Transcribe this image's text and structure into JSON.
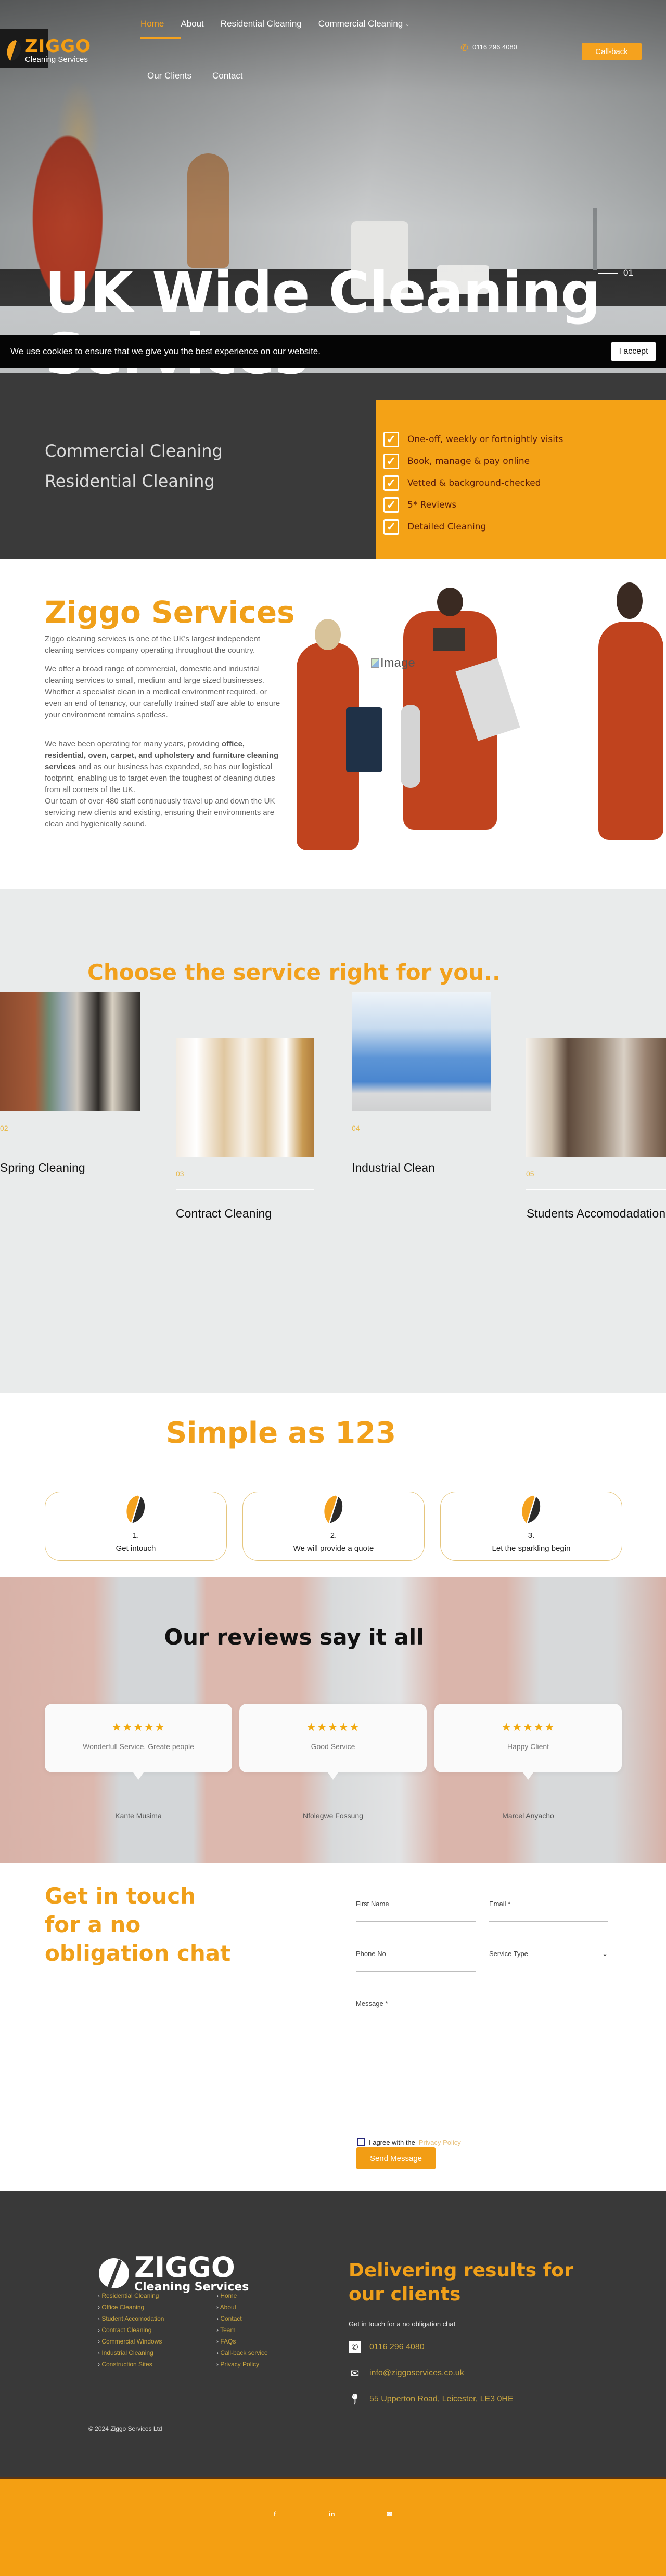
{
  "brand": {
    "name": "ZIGGO",
    "tagline": "Cleaning Services",
    "accent_color": "#f5a21e",
    "dark_color": "#3a3a3a"
  },
  "header": {
    "nav": [
      {
        "label": "Home",
        "active": true
      },
      {
        "label": "About"
      },
      {
        "label": "Residential Cleaning"
      },
      {
        "label": "Commercial Cleaning",
        "has_dropdown": true
      },
      {
        "label": "Our Clients"
      },
      {
        "label": "Contact"
      }
    ],
    "phone": "0116 296 4080",
    "callback_label": "Call-back"
  },
  "hero": {
    "title": "UK Wide Cleaning Services",
    "slide_number": "01",
    "links": [
      "Commercial Cleaning",
      "Residential Cleaning"
    ],
    "features": [
      "One-off, weekly or fortnightly visits",
      "Book, manage & pay online",
      "Vetted & background-checked",
      "5* Reviews",
      "Detailed Cleaning"
    ]
  },
  "cookie": {
    "text": "We use cookies to ensure that we give you the best experience on our website.",
    "accept_label": "I accept"
  },
  "about": {
    "title": "Ziggo Services",
    "p1": "Ziggo cleaning services is one of the UK's largest independent cleaning services company operating throughout the country.",
    "p2": "We offer a broad range of commercial, domestic and industrial cleaning services to small, medium and large sized businesses. Whether a specialist clean in a medical environment required, or even an end of tenancy, our carefully trained staff are able to ensure your environment remains spotless.",
    "p3_start": "We have been operating for many years, providing ",
    "p3_bold": "office, residential, oven, carpet, and upholstery and furniture cleaning services",
    "p3_end": " and as our business has expanded, so has our logistical footprint, enabling us to target even the toughest of cleaning duties from all corners of the UK.",
    "p4": "Our team of over 480 staff continuously travel up and down the UK servicing new clients and existing, ensuring their environments are clean and hygienically sound.",
    "image_alt": "Image"
  },
  "services": {
    "title": "Choose the service right for you..",
    "items": [
      {
        "num": "02",
        "title": "Spring Cleaning"
      },
      {
        "num": "03",
        "title": "Contract Cleaning"
      },
      {
        "num": "04",
        "title": "Industrial Clean"
      },
      {
        "num": "05",
        "title": "Students Accomodadation"
      }
    ]
  },
  "steps": {
    "title": "Simple as 123",
    "items": [
      {
        "num": "1.",
        "label": "Get intouch"
      },
      {
        "num": "2.",
        "label": "We will provide a quote"
      },
      {
        "num": "3.",
        "label": "Let the sparkling begin"
      }
    ]
  },
  "reviews": {
    "title": "Our reviews say it all",
    "items": [
      {
        "rating": 5,
        "stars": "★★★★★",
        "text": "Wonderfull Service, Greate people",
        "name": "Kante Musima"
      },
      {
        "rating": 5,
        "stars": "★★★★★",
        "text": "Good Service",
        "name": "Nfolegwe Fossung"
      },
      {
        "rating": 5,
        "stars": "★★★★★",
        "text": "Happy Client",
        "name": "Marcel Anyacho"
      }
    ]
  },
  "contact": {
    "title": "Get in touch for a no obligation chat",
    "fields": {
      "first_name": "First Name",
      "email": "Email *",
      "phone": "Phone No",
      "service_type": "Service Type",
      "message": "Message *"
    },
    "agree_text": "I agree with the",
    "privacy_link": "Privacy Policy",
    "send_label": "Send Message"
  },
  "footer": {
    "services_links": [
      "Residential Cleaning",
      "Office Cleaning",
      "Student Accomodation",
      "Contract Cleaning",
      "Commercial Windows",
      "Industrial Cleaning",
      "Construction Sites"
    ],
    "site_links": [
      "Home",
      "About",
      "Contact",
      "Team",
      "FAQs",
      "Call-back service",
      "Privacy Policy"
    ],
    "copyright": "© 2024 Ziggo Services Ltd",
    "heading": "Delivering results for our clients",
    "subheading": "Get in touch for a no obligation chat",
    "phone": "0116 296 4080",
    "email": "info@ziggoservices.co.uk",
    "address": "55 Upperton Road, Leicester, LE3 0HE",
    "social": [
      {
        "icon": "facebook-icon",
        "glyph": "f"
      },
      {
        "icon": "linkedin-icon",
        "glyph": "in"
      },
      {
        "icon": "email-icon",
        "glyph": "✉"
      }
    ]
  }
}
